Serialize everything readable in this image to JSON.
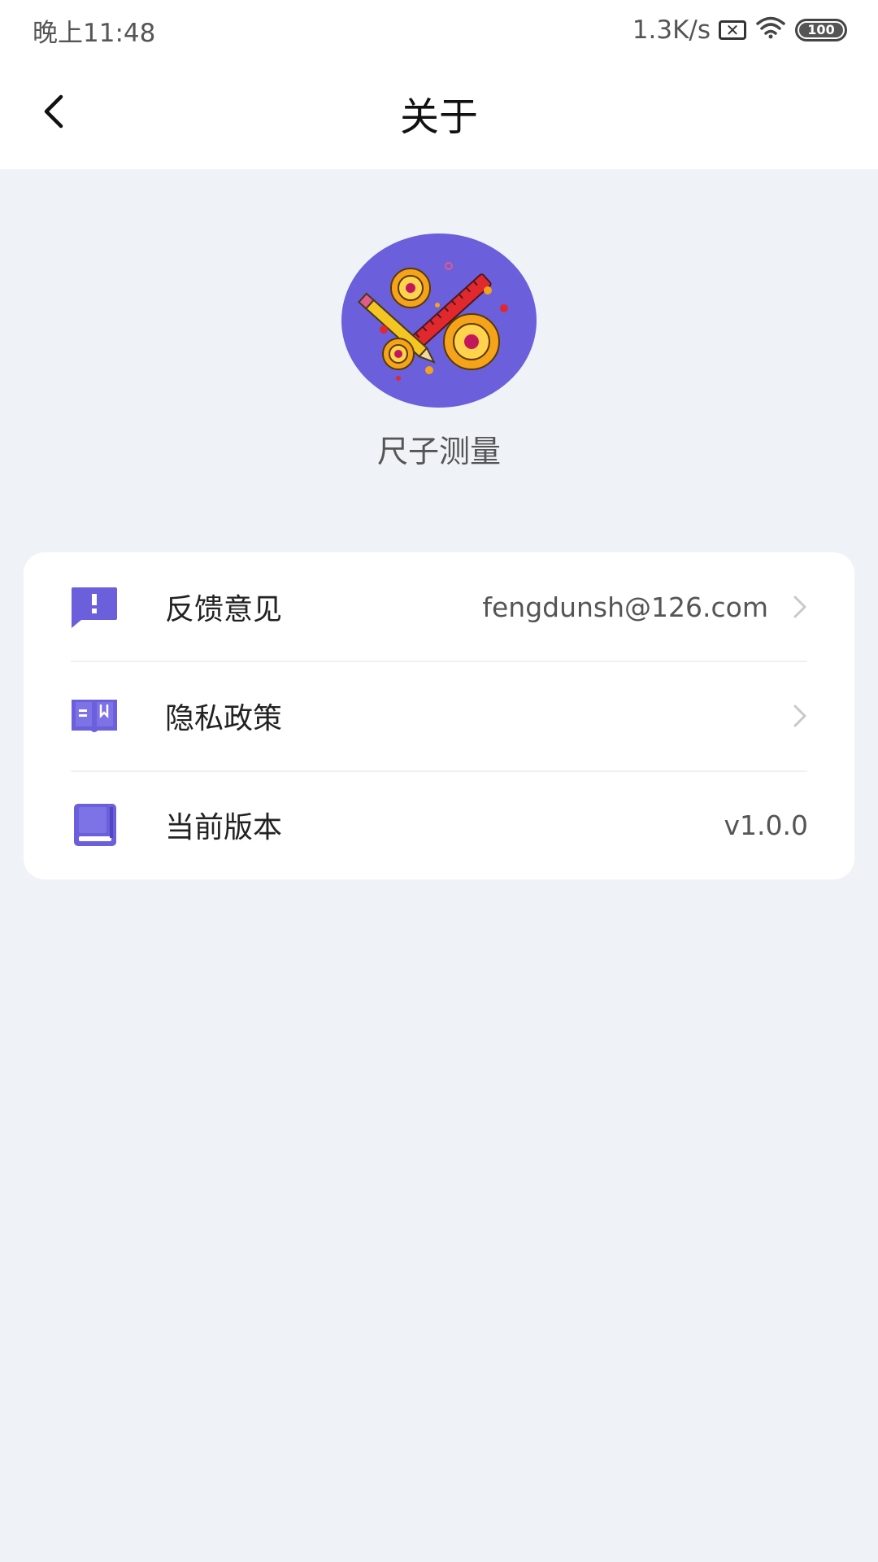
{
  "status_bar": {
    "time": "晚上11:48",
    "net_speed": "1.3K/s",
    "sim_icon": "sim-x-icon",
    "wifi_icon": "wifi-icon",
    "battery": "100"
  },
  "header": {
    "title": "关于",
    "back_icon": "chevron-left-icon"
  },
  "app": {
    "name": "尺子测量",
    "logo_icon": "gears-ruler-pencil-logo"
  },
  "colors": {
    "accent": "#6b5fdb",
    "background": "#eff3f7",
    "card": "#ffffff"
  },
  "settings": {
    "items": [
      {
        "label": "反馈意见",
        "value": "fengdunsh@126.com",
        "icon": "feedback-icon",
        "has_arrow": true
      },
      {
        "label": "隐私政策",
        "value": "",
        "icon": "book-icon",
        "has_arrow": true
      },
      {
        "label": "当前版本",
        "value": "v1.0.0",
        "icon": "version-icon",
        "has_arrow": false
      }
    ]
  }
}
